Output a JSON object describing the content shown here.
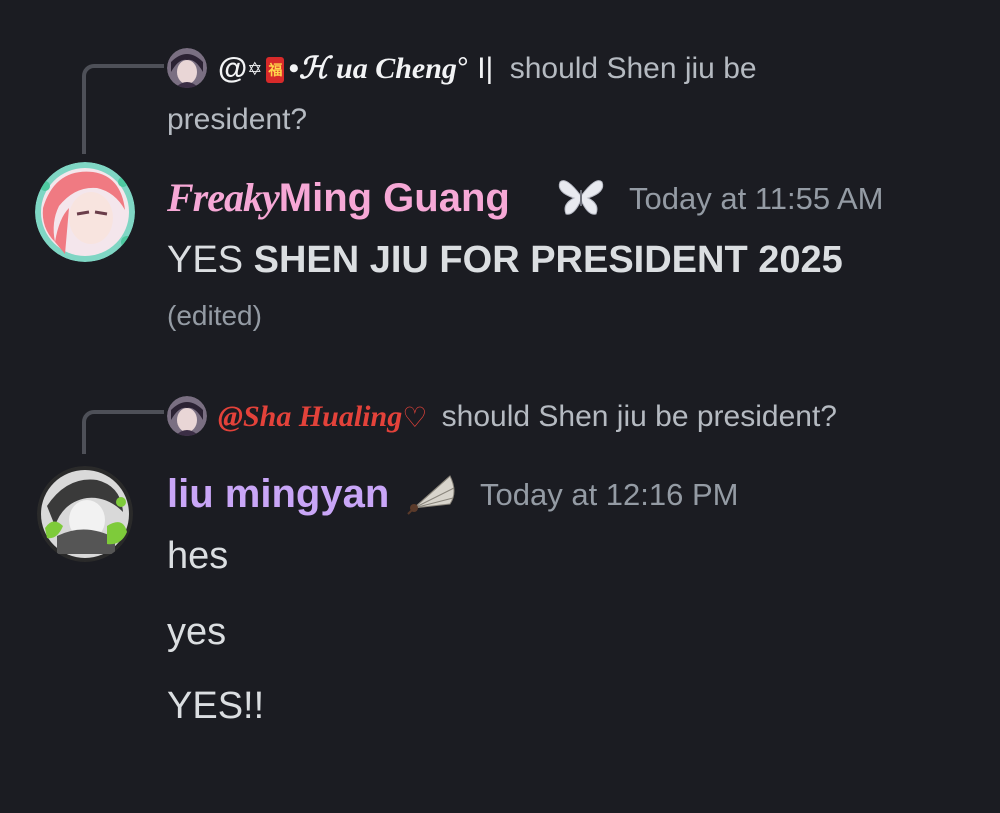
{
  "messages": [
    {
      "reply": {
        "handle_prefix": "@",
        "handle_star": "✡",
        "handle_fu": "福",
        "handle_name": "•ℋ ua Cheng",
        "handle_suffix": "° I|",
        "text_line1": "should Shen jiu be",
        "text_line2": "president?"
      },
      "author": {
        "display_script": "Freaky",
        "name": "Ming Guang",
        "badge_icon": "butterfly-icon"
      },
      "timestamp": "Today at 11:55 AM",
      "content_plain": "YES ",
      "content_bold": "SHEN JIU FOR PRESIDENT 2025",
      "edited_label": "(edited)"
    },
    {
      "reply": {
        "handle": "@Sha Hualing",
        "heart_icon": "heart-icon",
        "text": "should Shen jiu be president?"
      },
      "author": {
        "name": "liu mingyan",
        "badge_icon": "fan-icon"
      },
      "timestamp": "Today at 12:16 PM",
      "lines": [
        "hes",
        "yes",
        "YES!!"
      ]
    }
  ],
  "colors": {
    "background": "#1b1c22",
    "username_pink": "#f6a8d6",
    "username_purple": "#c9a6f7",
    "handle_red": "#e3423a",
    "timestamp": "#949ba4",
    "text": "#dbdee1"
  }
}
